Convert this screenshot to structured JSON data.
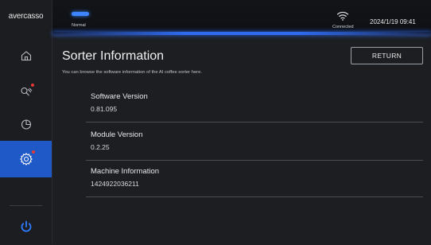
{
  "app": {
    "logo_text": "avercasso"
  },
  "sidebar": {
    "items": [
      {
        "name": "home",
        "icon": "home-icon",
        "active": false
      },
      {
        "name": "sorter-tools",
        "icon": "tools-icon",
        "active": false,
        "badge": true
      },
      {
        "name": "statistics",
        "icon": "pie-chart-icon",
        "active": false
      },
      {
        "name": "settings",
        "icon": "gear-icon",
        "active": true,
        "badge": true
      }
    ],
    "power_icon": "power-icon"
  },
  "topbar": {
    "status_label": "Normal",
    "connection_label": "Connected",
    "datetime": "2024/1/19 09:41"
  },
  "main": {
    "title": "Sorter Information",
    "description": "You can browse the software information of the AI coffee sorter here.",
    "return_label": "RETURN",
    "rows": [
      {
        "label": "Software Version",
        "value": "0.81.095"
      },
      {
        "label": "Module Version",
        "value": "0.2.25"
      },
      {
        "label": "Machine Information",
        "value": "1424922036211"
      }
    ]
  },
  "colors": {
    "accent": "#1f58c7",
    "status_glow": "#3d86ff",
    "badge": "#e53935",
    "power": "#2f7bff"
  }
}
